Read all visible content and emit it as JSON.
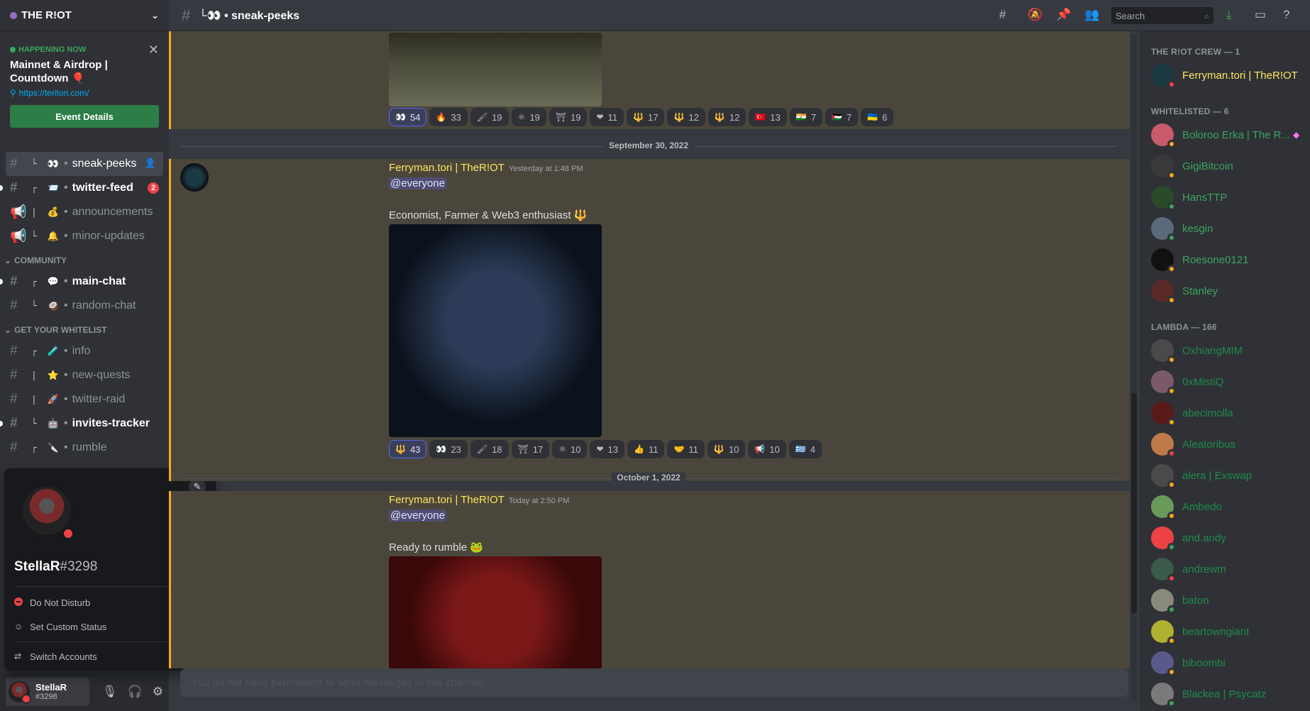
{
  "server": {
    "name": "THE R!OT"
  },
  "event": {
    "badge": "HAPPENING NOW",
    "title": "Mainnet & Airdrop | Countdown",
    "title_emoji": "🎈",
    "url": "https://teritori.com/",
    "button": "Event Details"
  },
  "channels": [
    {
      "tree": "└",
      "emoji": "👀",
      "name": "sneak-peeks",
      "type": "text",
      "state": "active"
    },
    {
      "tree": "┌",
      "emoji": "📨",
      "name": "twitter-feed",
      "type": "text",
      "state": "unread",
      "badge": "2"
    },
    {
      "tree": "|",
      "emoji": "💰",
      "name": "announcements",
      "type": "announce",
      "state": "normal"
    },
    {
      "tree": "└",
      "emoji": "🔔",
      "name": "minor-updates",
      "type": "announce",
      "state": "normal"
    }
  ],
  "categories": {
    "community": "COMMUNITY",
    "whitelist": "GET YOUR WHITELIST"
  },
  "community_channels": [
    {
      "tree": "┌",
      "emoji": "💬",
      "name": "main-chat",
      "state": "unread"
    },
    {
      "tree": "└",
      "emoji": "🥥",
      "name": "random-chat",
      "state": "normal"
    }
  ],
  "whitelist_channels": [
    {
      "tree": "┌",
      "emoji": "🧪",
      "name": "info",
      "state": "normal"
    },
    {
      "tree": "|",
      "emoji": "⭐",
      "name": "new-quests",
      "state": "normal"
    },
    {
      "tree": "|",
      "emoji": "🚀",
      "name": "twitter-raid",
      "state": "normal"
    },
    {
      "tree": "└",
      "emoji": "🤖",
      "name": "invites-tracker",
      "state": "unread"
    },
    {
      "tree": "┌",
      "emoji": "🔪",
      "name": "rumble",
      "state": "normal"
    }
  ],
  "popout": {
    "username": "StellaR",
    "discriminator": "#3298",
    "items": [
      {
        "label": "Do Not Disturb",
        "has_arrow": true
      },
      {
        "label": "Set Custom Status",
        "has_arrow": false
      },
      {
        "label": "Switch Accounts",
        "has_arrow": true
      }
    ]
  },
  "user_panel": {
    "name": "StellaR",
    "tag": "#3298"
  },
  "topbar": {
    "channel": "sneak-peeks",
    "prefix": "└👀 • ",
    "search_placeholder": "Search"
  },
  "messages": [
    {
      "reactions": [
        {
          "emoji": "👀",
          "count": "54",
          "me": true
        },
        {
          "emoji": "🔥",
          "count": "33"
        },
        {
          "emoji": "🖌",
          "count": "19"
        },
        {
          "emoji": "⚛",
          "count": "19"
        },
        {
          "emoji": "⛩",
          "count": "19"
        },
        {
          "emoji": "❤",
          "count": "11"
        },
        {
          "emoji": "🔱",
          "count": "17"
        },
        {
          "emoji": "🔱",
          "count": "12"
        },
        {
          "emoji": "🔱",
          "count": "12"
        },
        {
          "emoji": "🇹🇷",
          "count": "13"
        },
        {
          "emoji": "🇮🇳",
          "count": "7"
        },
        {
          "emoji": "🇵🇸",
          "count": "7"
        },
        {
          "emoji": "🇺🇦",
          "count": "6"
        }
      ]
    },
    {
      "date_divider": "September 30, 2022",
      "author": "Ferryman.tori | TheR!OT",
      "time": "Yesterday at 1:48 PM",
      "mention": "@everyone",
      "text": "Economist, Farmer & Web3 enthusiast",
      "text_emoji": "🔱",
      "reactions": [
        {
          "emoji": "🔱",
          "count": "43",
          "me": true
        },
        {
          "emoji": "👀",
          "count": "23"
        },
        {
          "emoji": "🖌",
          "count": "18"
        },
        {
          "emoji": "⛩",
          "count": "17"
        },
        {
          "emoji": "⚛",
          "count": "10"
        },
        {
          "emoji": "❤",
          "count": "13"
        },
        {
          "emoji": "👍",
          "count": "11"
        },
        {
          "emoji": "🤝",
          "count": "11"
        },
        {
          "emoji": "🔱",
          "count": "10"
        },
        {
          "emoji": "📢",
          "count": "10"
        },
        {
          "emoji": "🇬🇷",
          "count": "4"
        }
      ]
    },
    {
      "date_divider": "October 1, 2022",
      "author": "Ferryman.tori | TheR!OT",
      "time": "Today at 2:50 PM",
      "mention": "@everyone",
      "text": "Ready to rumble",
      "text_emoji": "🐸"
    }
  ],
  "composer": {
    "placeholder": "You do not have permission to send messages in this channel."
  },
  "members": {
    "groups": [
      {
        "title": "THE R!OT CREW — 1",
        "members": [
          {
            "name": "Ferryman.tori | TheR!OT",
            "color": "#fee75c",
            "status": "#ed4245",
            "avatar": "#1c3a44"
          }
        ]
      },
      {
        "title": "WHITELISTED — 6",
        "members": [
          {
            "name": "Boloroo Erka | The R...",
            "color": "#3ba55d",
            "status": "#faa61a",
            "avatar": "#c85a6a",
            "boost": "◆"
          },
          {
            "name": "GigiBitcoin",
            "color": "#3ba55d",
            "status": "#faa61a",
            "avatar": "#3a3a3a"
          },
          {
            "name": "HansTTP",
            "color": "#3ba55d",
            "status": "#3ba55d",
            "avatar": "#2a4a2a"
          },
          {
            "name": "kesgin",
            "color": "#3ba55d",
            "status": "#3ba55d",
            "avatar": "#5a6a7a"
          },
          {
            "name": "Roesone0121",
            "color": "#3ba55d",
            "status": "#faa61a",
            "avatar": "#111111"
          },
          {
            "name": "Stanley",
            "color": "#3ba55d",
            "status": "#faa61a",
            "avatar": "#5a2a2a"
          }
        ]
      },
      {
        "title": "LAMBDA — 166",
        "members": [
          {
            "name": "OxhiangMIM",
            "color": "#1f8b4c",
            "status": "#faa61a",
            "avatar": "#4a4a4a"
          },
          {
            "name": "0xMistiQ",
            "color": "#1f8b4c",
            "status": "#faa61a",
            "avatar": "#7a5a6a"
          },
          {
            "name": "abecimolla",
            "color": "#1f8b4c",
            "status": "#faa61a",
            "avatar": "#5a1a1a"
          },
          {
            "name": "Aleatoribus",
            "color": "#1f8b4c",
            "status": "#ed4245",
            "avatar": "#c07a4a"
          },
          {
            "name": "alera | Exswap",
            "color": "#1f8b4c",
            "status": "#faa61a",
            "avatar": "#4a4a4a"
          },
          {
            "name": "Ambedo",
            "color": "#1f8b4c",
            "status": "#faa61a",
            "avatar": "#6a9a5a"
          },
          {
            "name": "and.andy",
            "color": "#1f8b4c",
            "status": "#3ba55d",
            "avatar": "#ed4245"
          },
          {
            "name": "andrewm",
            "color": "#1f8b4c",
            "status": "#ed4245",
            "avatar": "#3a5a4a"
          },
          {
            "name": "baton",
            "color": "#1f8b4c",
            "status": "#3ba55d",
            "avatar": "#8a8a7a"
          },
          {
            "name": "beartowngiant",
            "color": "#1f8b4c",
            "status": "#faa61a",
            "avatar": "#b0b030"
          },
          {
            "name": "biboombi",
            "color": "#1f8b4c",
            "status": "#faa61a",
            "avatar": "#5a5a8a"
          },
          {
            "name": "Blackea | Psycatz",
            "color": "#1f8b4c",
            "status": "#3ba55d",
            "avatar": "#7a7a7a"
          }
        ]
      }
    ]
  }
}
